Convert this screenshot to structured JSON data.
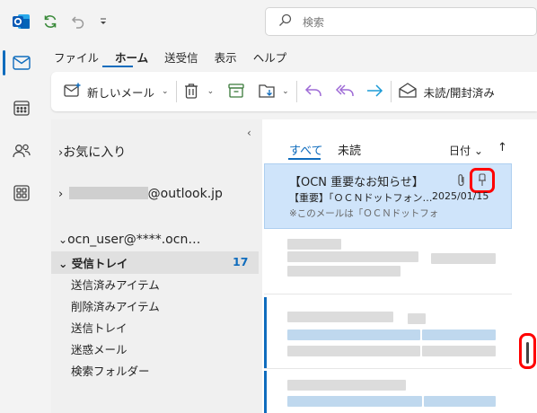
{
  "colors": {
    "accent": "#0f6cbd",
    "selected_bg": "#cfe4fa",
    "attach_highlight": "#ff0000"
  },
  "search": {
    "placeholder": "検索"
  },
  "menu": {
    "items": [
      "ファイル",
      "ホーム",
      "送受信",
      "表示",
      "ヘルプ"
    ],
    "active": "ホーム"
  },
  "ribbon": {
    "new_mail": "新しいメール",
    "read_unread": "未読/開封済み"
  },
  "folders": {
    "favorites": "お気に入り",
    "account1_domain": "@outlook.jp",
    "account2": "ocn_user@****.ocn…",
    "inbox": "受信トレイ",
    "inbox_count": "17",
    "items": [
      "送信済みアイテム",
      "削除済みアイテム",
      "送信トレイ",
      "迷惑メール",
      "検索フォルダー"
    ]
  },
  "list": {
    "tab_all": "すべて",
    "tab_unread": "未読",
    "sort": "日付",
    "messages": [
      {
        "sender": "【OCN 重要なお知らせ】",
        "subject": "【重要】「ＯＣＮドットフォン…",
        "date": "2025/01/15",
        "preview": "※このメールは「ＯＣＮドットフォ"
      }
    ]
  }
}
